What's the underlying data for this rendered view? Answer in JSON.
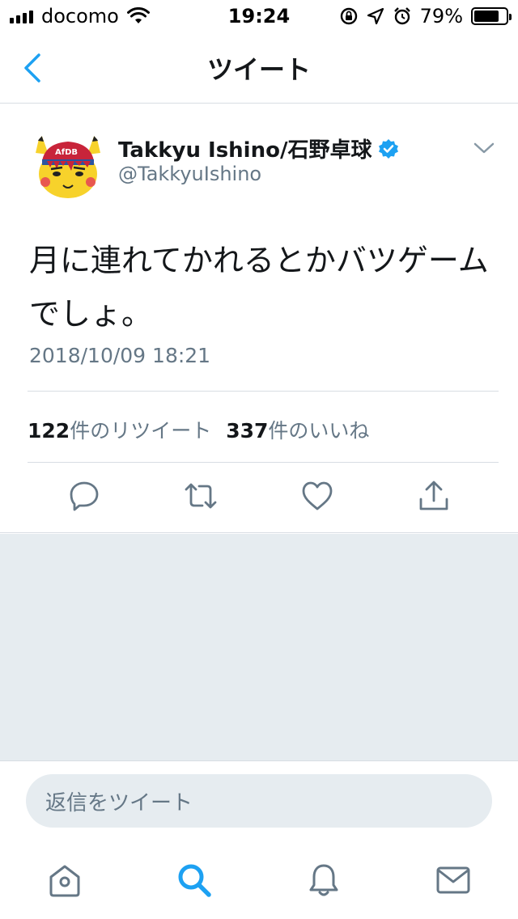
{
  "status_bar": {
    "carrier": "docomo",
    "time": "19:24",
    "battery": "79%",
    "battery_level": 0.79,
    "icons": [
      "signal-icon",
      "wifi-icon",
      "rotation-lock-icon",
      "location-icon",
      "alarm-icon",
      "battery-icon"
    ]
  },
  "nav": {
    "title": "ツイート",
    "back_icon": "back-arrow-icon"
  },
  "tweet": {
    "author_name": "Takkyu Ishino/石野卓球",
    "verified_icon": "verified-badge-icon",
    "author_handle": "@TakkyuIshino",
    "text": "月に連れてかれるとかバツゲームでしょ。",
    "timestamp": "2018/10/09 18:21",
    "retweet_count": "122",
    "retweet_label": "件のリツイート",
    "like_count": "337",
    "like_label": "件のいいね",
    "actions": [
      "reply-icon",
      "retweet-icon",
      "like-icon",
      "share-icon"
    ]
  },
  "reply": {
    "placeholder": "返信をツイート"
  },
  "tab_bar": {
    "tabs": [
      "home-icon",
      "search-icon",
      "notifications-icon",
      "messages-icon"
    ],
    "active": "search-icon"
  },
  "colors": {
    "accent": "#1da1f2",
    "text_primary": "#14171a",
    "text_secondary": "#657786",
    "divider": "#d8dde3",
    "background_gray": "#e6ecf0"
  }
}
